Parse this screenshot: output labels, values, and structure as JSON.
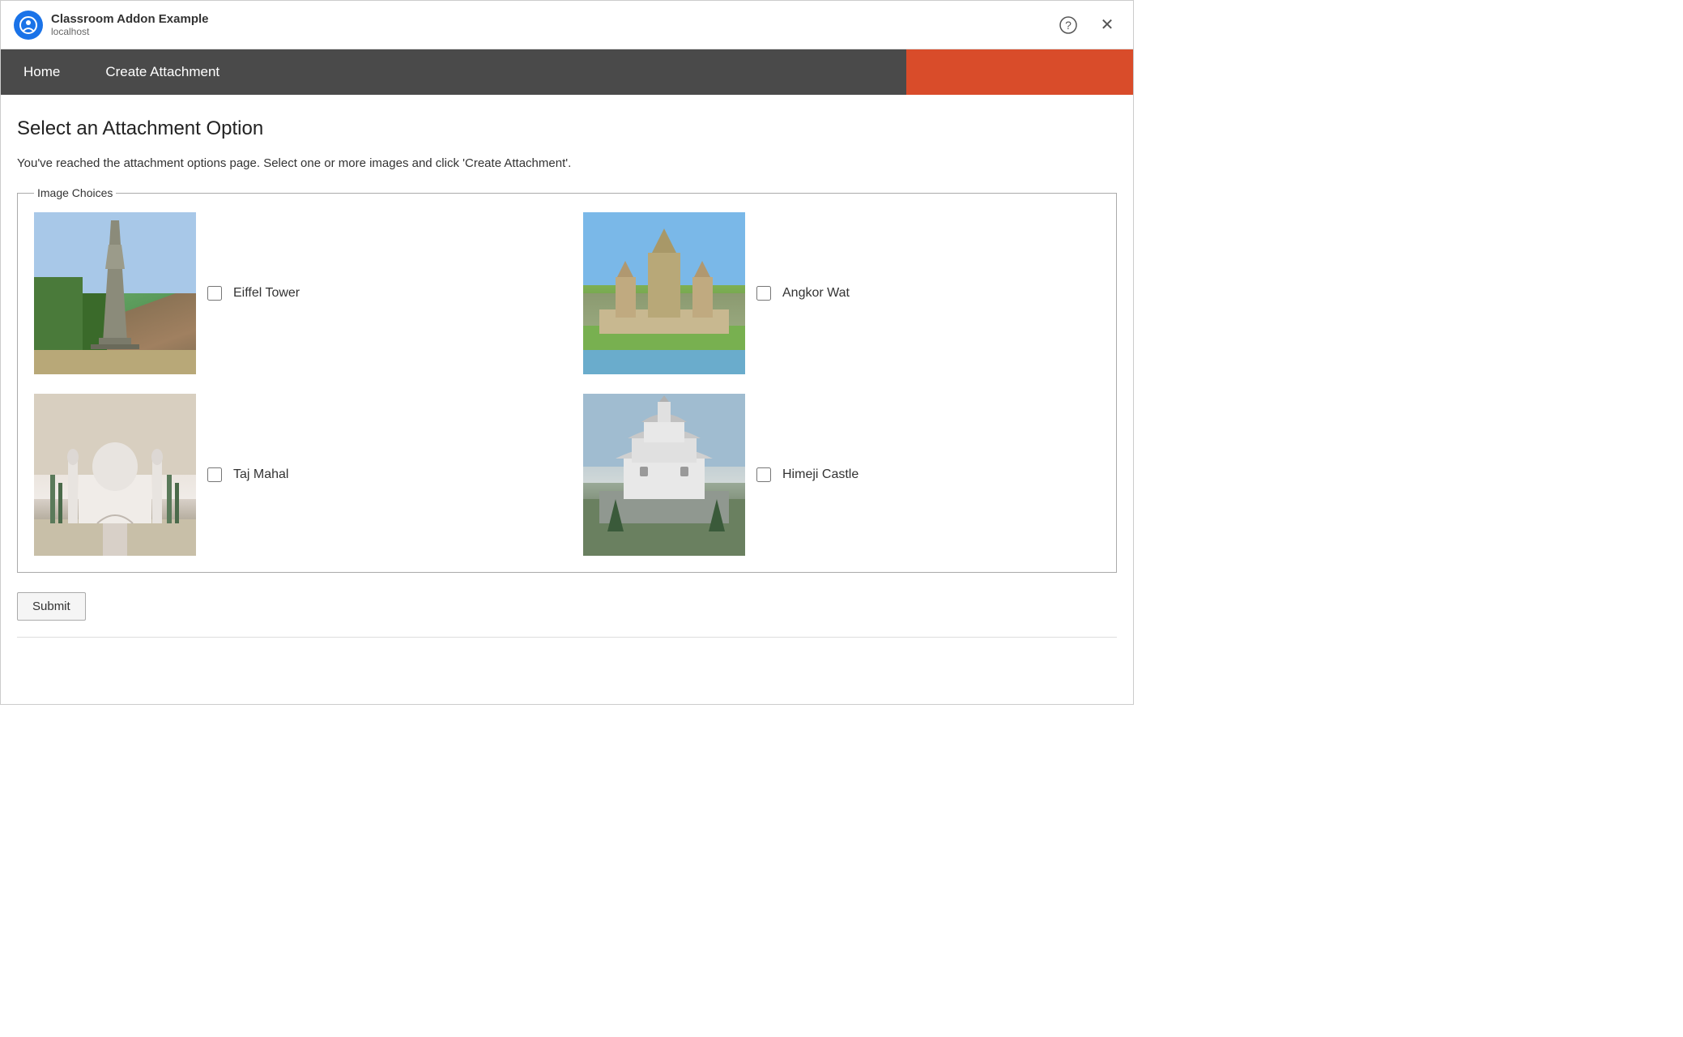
{
  "window": {
    "app_name": "Classroom Addon Example",
    "app_url": "localhost"
  },
  "nav": {
    "home_label": "Home",
    "create_attachment_label": "Create Attachment"
  },
  "page": {
    "heading": "Select an Attachment Option",
    "description": "You've reached the attachment options page. Select one or more images and click 'Create Attachment'.",
    "fieldset_legend": "Image Choices",
    "submit_label": "Submit",
    "images": [
      {
        "id": "eiffel",
        "label": "Eiffel Tower"
      },
      {
        "id": "angkor",
        "label": "Angkor Wat"
      },
      {
        "id": "taj",
        "label": "Taj Mahal"
      },
      {
        "id": "himeji",
        "label": "Himeji Castle"
      }
    ]
  },
  "icons": {
    "help": "?",
    "close": "✕"
  }
}
